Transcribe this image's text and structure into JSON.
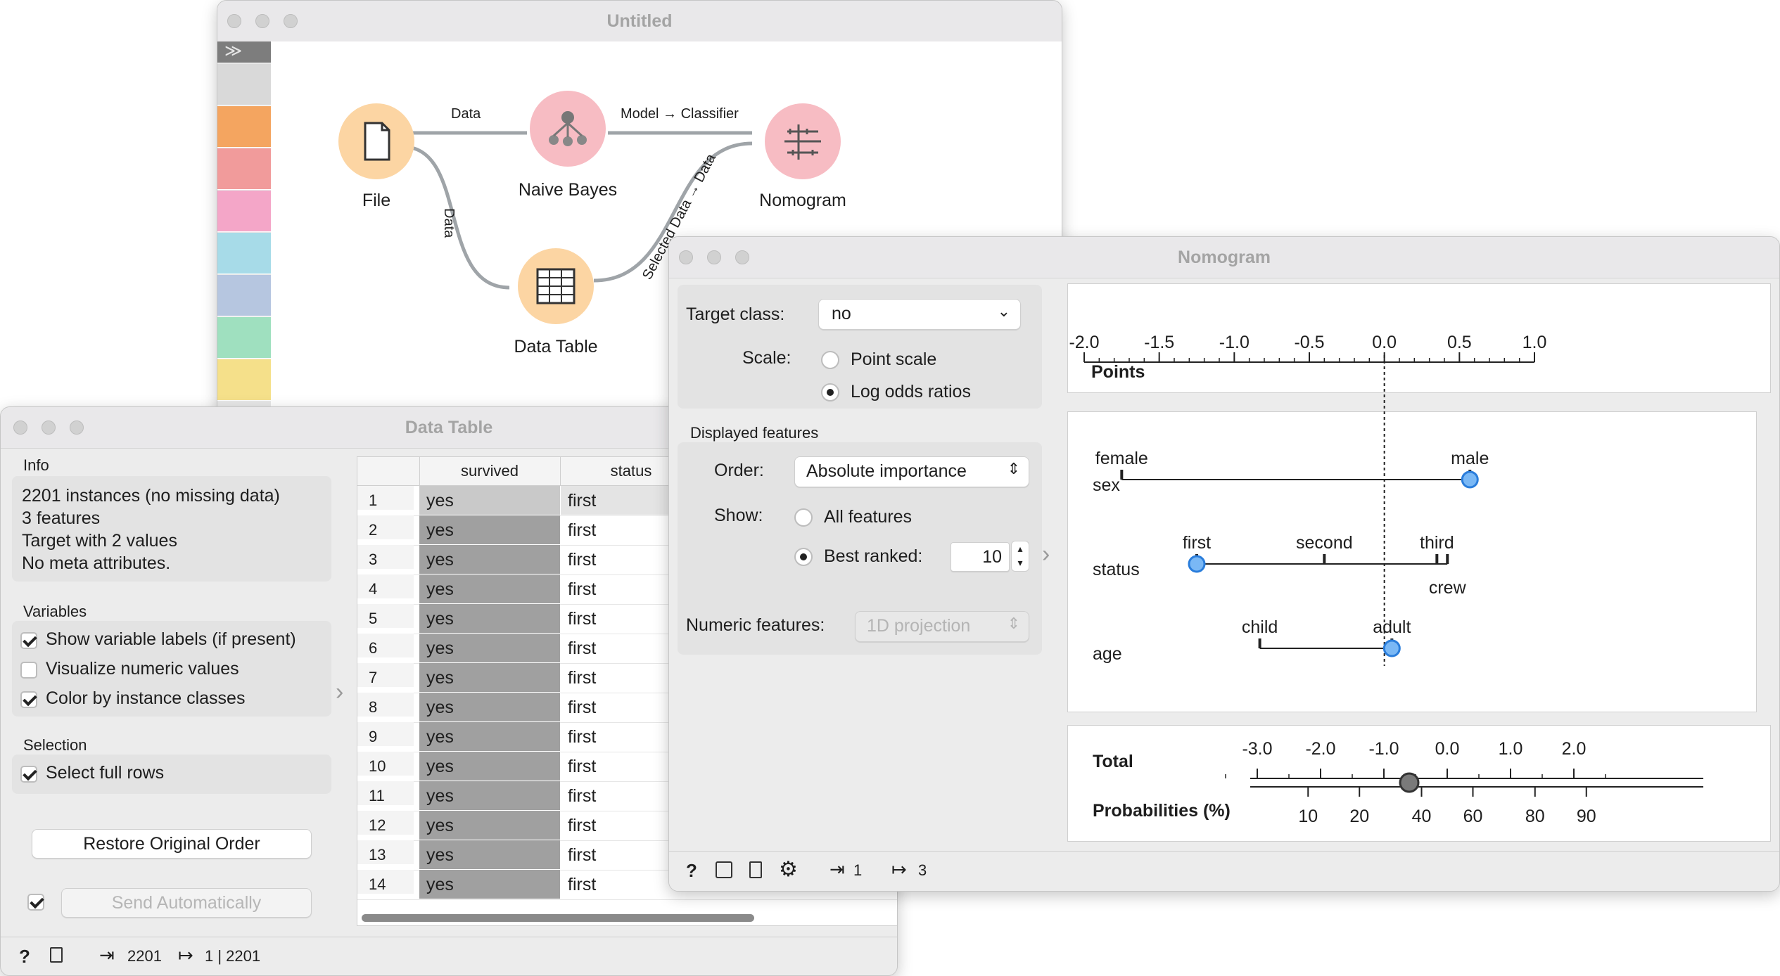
{
  "canvas": {
    "title": "Untitled",
    "widgets": {
      "file": "File",
      "naive_bayes": "Naive Bayes",
      "nomogram": "Nomogram",
      "data_table": "Data Table"
    },
    "links": {
      "file_nb": "Data",
      "file_table": "Data",
      "nb_nomo": "Model → Classifier",
      "table_nomo": "Selected Data → Data"
    },
    "toolbox_colors": [
      "#d9d9d9",
      "#f4a560",
      "#f19b9b",
      "#f4a6c8",
      "#a7dbe8",
      "#b6c6e0",
      "#9fe0bf",
      "#f5e08a"
    ]
  },
  "data_table": {
    "title": "Data Table",
    "info_header": "Info",
    "info_lines": [
      "2201 instances (no missing data)",
      "3 features",
      "Target with 2 values",
      "No meta attributes."
    ],
    "variables_header": "Variables",
    "opt_labels": "Show variable labels (if present)",
    "opt_visualize": "Visualize numeric values",
    "opt_color": "Color by instance classes",
    "selection_header": "Selection",
    "opt_full_rows": "Select full rows",
    "restore_button": "Restore Original Order",
    "send_button": "Send Automatically",
    "columns": [
      "survived",
      "status"
    ],
    "rows": [
      {
        "n": "1",
        "survived": "yes",
        "status": "first"
      },
      {
        "n": "2",
        "survived": "yes",
        "status": "first"
      },
      {
        "n": "3",
        "survived": "yes",
        "status": "first"
      },
      {
        "n": "4",
        "survived": "yes",
        "status": "first"
      },
      {
        "n": "5",
        "survived": "yes",
        "status": "first"
      },
      {
        "n": "6",
        "survived": "yes",
        "status": "first"
      },
      {
        "n": "7",
        "survived": "yes",
        "status": "first"
      },
      {
        "n": "8",
        "survived": "yes",
        "status": "first"
      },
      {
        "n": "9",
        "survived": "yes",
        "status": "first"
      },
      {
        "n": "10",
        "survived": "yes",
        "status": "first"
      },
      {
        "n": "11",
        "survived": "yes",
        "status": "first"
      },
      {
        "n": "12",
        "survived": "yes",
        "status": "first"
      },
      {
        "n": "13",
        "survived": "yes",
        "status": "first"
      },
      {
        "n": "14",
        "survived": "yes",
        "status": "first"
      }
    ],
    "status_in": "2201",
    "status_out": "1 | 2201"
  },
  "nomogram": {
    "title": "Nomogram",
    "target_label": "Target class:",
    "target_value": "no",
    "scale_label": "Scale:",
    "scale_point": "Point scale",
    "scale_log": "Log odds ratios",
    "displayed_header": "Displayed features",
    "order_label": "Order:",
    "order_value": "Absolute importance",
    "show_label": "Show:",
    "show_all": "All features",
    "show_best": "Best ranked:",
    "best_value": "10",
    "numeric_label": "Numeric features:",
    "numeric_value": "1D projection",
    "points_label": "Points",
    "points_ticks": [
      "-2.0",
      "-1.5",
      "-1.0",
      "-0.5",
      "0.0",
      "0.5",
      "1.0"
    ],
    "points_range": [
      -2.0,
      1.0
    ],
    "features": [
      {
        "name": "sex",
        "values": [
          {
            "label": "female",
            "v": -1.75
          },
          {
            "label": "male",
            "v": 0.57
          }
        ],
        "selected": 0.57
      },
      {
        "name": "status",
        "values": [
          {
            "label": "first",
            "v": -1.25
          },
          {
            "label": "second",
            "v": -0.4
          },
          {
            "label": "third",
            "v": 0.35
          },
          {
            "label": "crew",
            "v": 0.42
          }
        ],
        "selected": -1.25
      },
      {
        "name": "age",
        "values": [
          {
            "label": "child",
            "v": -0.83
          },
          {
            "label": "adult",
            "v": 0.05
          }
        ],
        "selected": 0.05
      }
    ],
    "total_label": "Total",
    "total_ticks": [
      "-3.0",
      "-2.0",
      "-1.0",
      "0.0",
      "1.0",
      "2.0"
    ],
    "total_value": -0.6,
    "prob_label": "Probabilities (%)",
    "prob_ticks": [
      "10",
      "20",
      "40",
      "60",
      "80",
      "90"
    ],
    "status_in": "1",
    "status_out": "3"
  },
  "colors": {
    "widget_orange": "#fcd5a3",
    "widget_pink": "#f7bcc3",
    "yes_cell": "#a0a0a0",
    "marker_blue": "#7ab8f5"
  }
}
